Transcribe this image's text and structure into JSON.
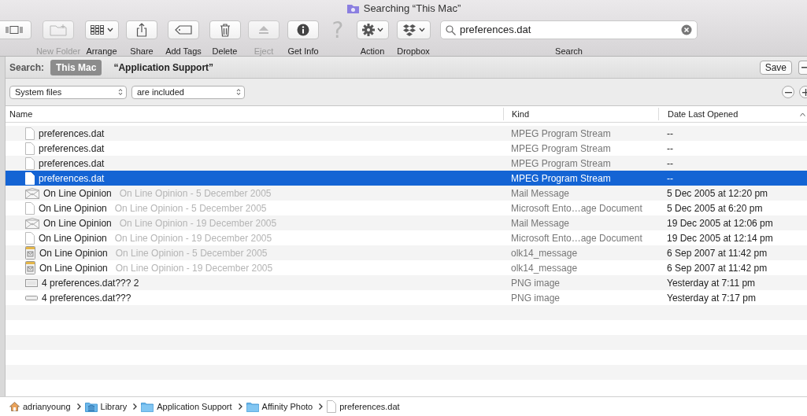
{
  "window": {
    "title": "Searching “This Mac”"
  },
  "toolbar": [
    {
      "label": "New Folder",
      "disabled": true,
      "menu": false
    },
    {
      "label": "Arrange",
      "disabled": false,
      "menu": true
    },
    {
      "label": "Share",
      "disabled": false,
      "menu": false
    },
    {
      "label": "Add Tags",
      "disabled": false,
      "menu": false
    },
    {
      "label": "Delete",
      "disabled": false,
      "menu": false
    },
    {
      "label": "Eject",
      "disabled": true,
      "menu": false
    },
    {
      "label": "Get Info",
      "disabled": false,
      "menu": false
    },
    {
      "glyph": "?",
      "disabled": true
    },
    {
      "label": "Action",
      "disabled": false,
      "menu": true
    },
    {
      "label": "Dropbox",
      "disabled": false,
      "menu": true
    }
  ],
  "search": {
    "value": "preferences.dat",
    "label": "Search"
  },
  "scope_bar": {
    "label": "Search:",
    "scopes": [
      {
        "label": "This Mac",
        "selected": true
      },
      {
        "label": "“Application Support”",
        "selected": false
      }
    ],
    "save": "Save"
  },
  "criteria": [
    {
      "value": "System files"
    },
    {
      "value": "are included"
    }
  ],
  "table": {
    "columns": [
      {
        "label": "Name",
        "sorted": false
      },
      {
        "label": "Kind",
        "sorted": false
      },
      {
        "label": "Date Last Opened",
        "sorted": true
      }
    ],
    "rows": [
      {
        "kind": "document",
        "name": "preferences.dat",
        "file_kind": "MPEG Program Stream",
        "date": "--",
        "selected": false
      },
      {
        "kind": "document",
        "name": "preferences.dat",
        "file_kind": "MPEG Program Stream",
        "date": "--",
        "selected": false
      },
      {
        "kind": "document",
        "name": "preferences.dat",
        "file_kind": "MPEG Program Stream",
        "date": "--",
        "selected": false
      },
      {
        "kind": "document",
        "name": "preferences.dat",
        "file_kind": "MPEG Program Stream",
        "date": "--",
        "selected": true
      },
      {
        "kind": "mail",
        "name": "On Line Opinion",
        "subtitle": "On Line Opinion - 5 December 2005",
        "file_kind": "Mail Message",
        "date": "5 Dec 2005 at 12:20 pm",
        "selected": false
      },
      {
        "kind": "document",
        "name": "On Line Opinion",
        "subtitle": "On Line Opinion - 5 December 2005",
        "file_kind": "Microsoft Ento…age Document",
        "date": "5 Dec 2005 at 6:20 pm",
        "selected": false
      },
      {
        "kind": "mail",
        "name": "On Line Opinion",
        "subtitle": "On Line Opinion - 19 December 2005",
        "file_kind": "Mail Message",
        "date": "19 Dec 2005 at 12:06 pm",
        "selected": false
      },
      {
        "kind": "document",
        "name": "On Line Opinion",
        "subtitle": "On Line Opinion - 19 December 2005",
        "file_kind": "Microsoft Ento…age Document",
        "date": "19 Dec 2005 at 12:14 pm",
        "selected": false
      },
      {
        "kind": "message",
        "name": "On Line Opinion",
        "subtitle": "On Line Opinion - 5 December 2005",
        "file_kind": "olk14_message",
        "date": "6 Sep 2007 at 11:42 pm",
        "selected": false
      },
      {
        "kind": "message",
        "name": "On Line Opinion",
        "subtitle": "On Line Opinion - 19 December 2005",
        "file_kind": "olk14_message",
        "date": "6 Sep 2007 at 11:42 pm",
        "selected": false
      },
      {
        "kind": "image",
        "name": "4 preferences.dat??? 2",
        "file_kind": "PNG image",
        "date": "Yesterday at 7:11 pm",
        "selected": false
      },
      {
        "kind": "image-thin",
        "name": "4 preferences.dat???",
        "file_kind": "PNG image",
        "date": "Yesterday at 7:17 pm",
        "selected": false
      }
    ]
  },
  "path_bar": [
    {
      "kind": "home",
      "label": "adrianyoung"
    },
    {
      "kind": "library",
      "label": "Library"
    },
    {
      "kind": "folder",
      "label": "Application Support"
    },
    {
      "kind": "folder",
      "label": "Affinity Photo"
    },
    {
      "kind": "document",
      "label": "preferences.dat"
    }
  ]
}
